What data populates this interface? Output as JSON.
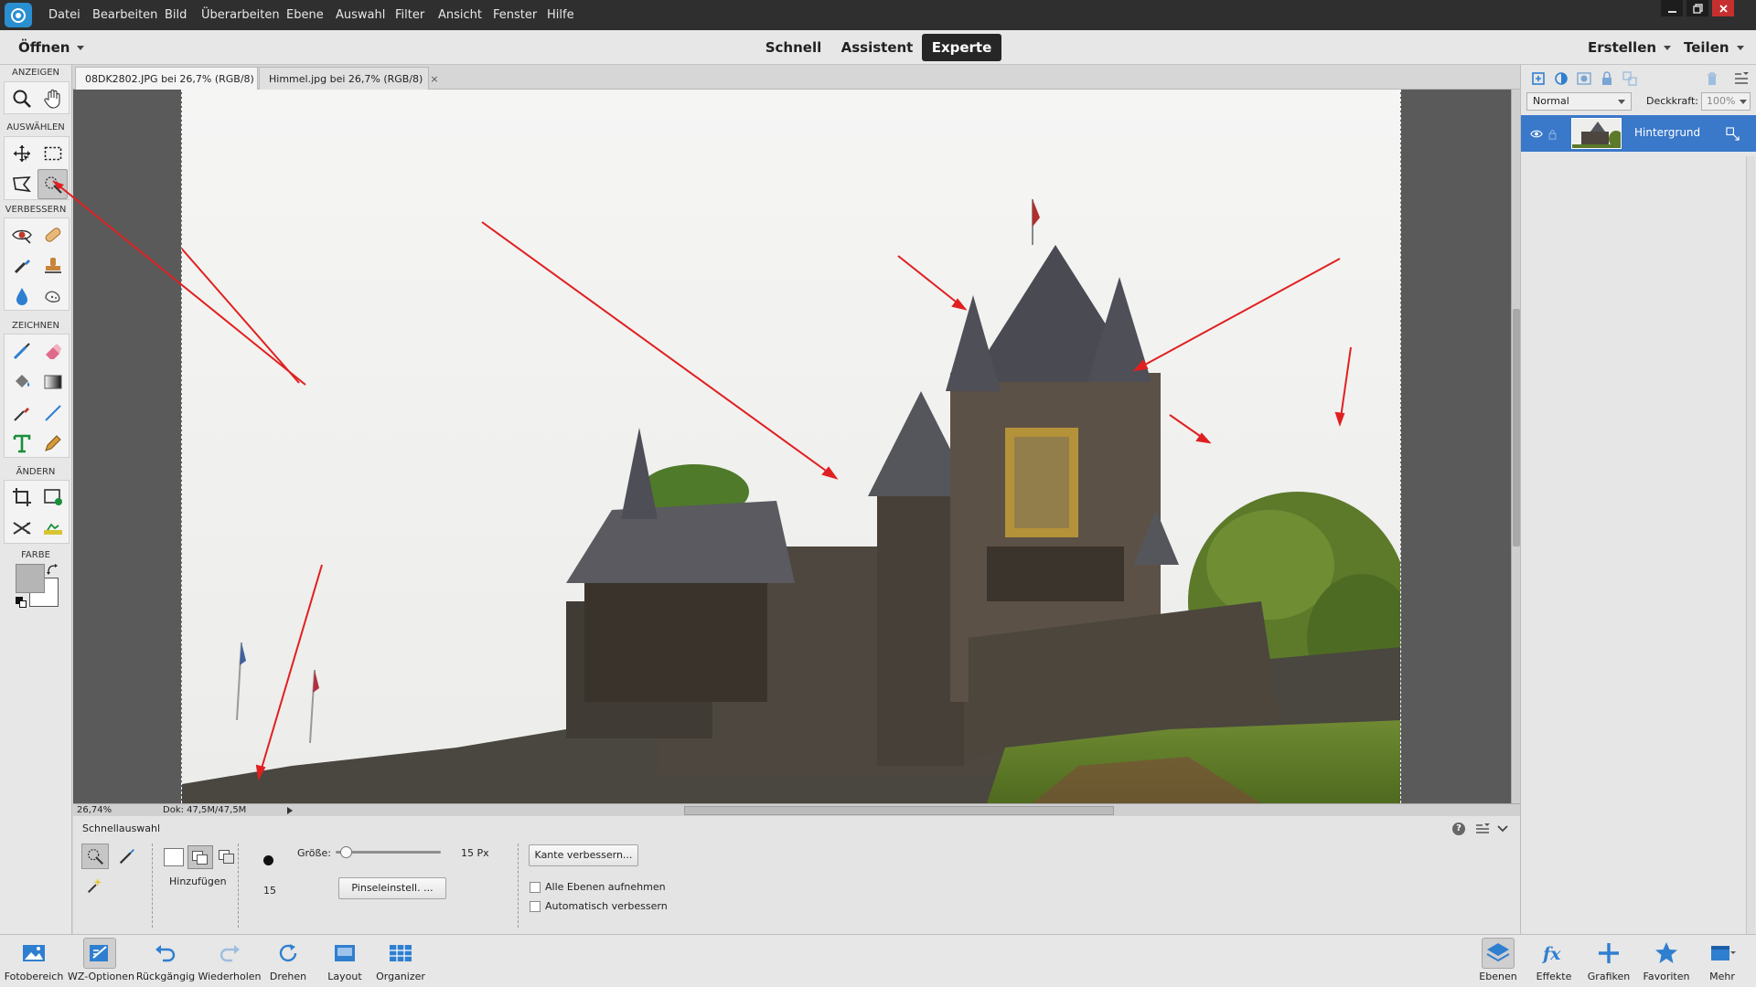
{
  "app": {
    "menu": [
      "Datei",
      "Bearbeiten",
      "Bild",
      "Überarbeiten",
      "Ebene",
      "Auswahl",
      "Filter",
      "Ansicht",
      "Fenster",
      "Hilfe"
    ]
  },
  "modebar": {
    "open_label": "Öffnen",
    "modes": [
      "Schnell",
      "Assistent",
      "Experte"
    ],
    "active_mode": "Experte",
    "create_label": "Erstellen",
    "share_label": "Teilen"
  },
  "toolbar": {
    "sections": [
      "ANZEIGEN",
      "AUSWÄHLEN",
      "VERBESSERN",
      "ZEICHNEN",
      "ÄNDERN",
      "FARBE"
    ],
    "colors": {
      "foreground": "#b5b5b5",
      "background": "#ffffff"
    }
  },
  "tabs": [
    {
      "label": "08DK2802.JPG bei 26,7% (RGB/8)",
      "close": "×",
      "active": true
    },
    {
      "label": "Himmel.jpg bei 26,7% (RGB/8)",
      "close": "×",
      "active": false
    }
  ],
  "status": {
    "zoom": "26,74%",
    "doc": "Dok: 47,5M/47,5M"
  },
  "tool_options": {
    "tool_name": "Schnellauswahl",
    "mode_label": "Hinzufügen",
    "brush_size_label": "Größe:",
    "size_value": "15 Px",
    "size_fraction": 0.05,
    "brush_number": "15",
    "brush_settings_button": "Pinseleinstell. ...",
    "refine_edge_button": "Kante verbessern...",
    "sample_all_layers": "Alle Ebenen aufnehmen",
    "sample_all_layers_checked": false,
    "auto_enhance": "Automatisch verbessern",
    "auto_enhance_checked": false
  },
  "layers_panel": {
    "blend_mode": "Normal",
    "opacity_label": "Deckkraft:",
    "opacity_value": "100%",
    "layer_name": "Hintergrund"
  },
  "taskbar": {
    "left": [
      "Fotobereich",
      "WZ-Optionen",
      "Rückgängig",
      "Wiederholen",
      "Drehen",
      "Layout",
      "Organizer"
    ],
    "right": [
      "Ebenen",
      "Effekte",
      "Grafiken",
      "Favoriten",
      "Mehr"
    ]
  },
  "colors": {
    "accent_selected_layer": "#3a78c9",
    "annotation_arrow": "#e02020"
  }
}
